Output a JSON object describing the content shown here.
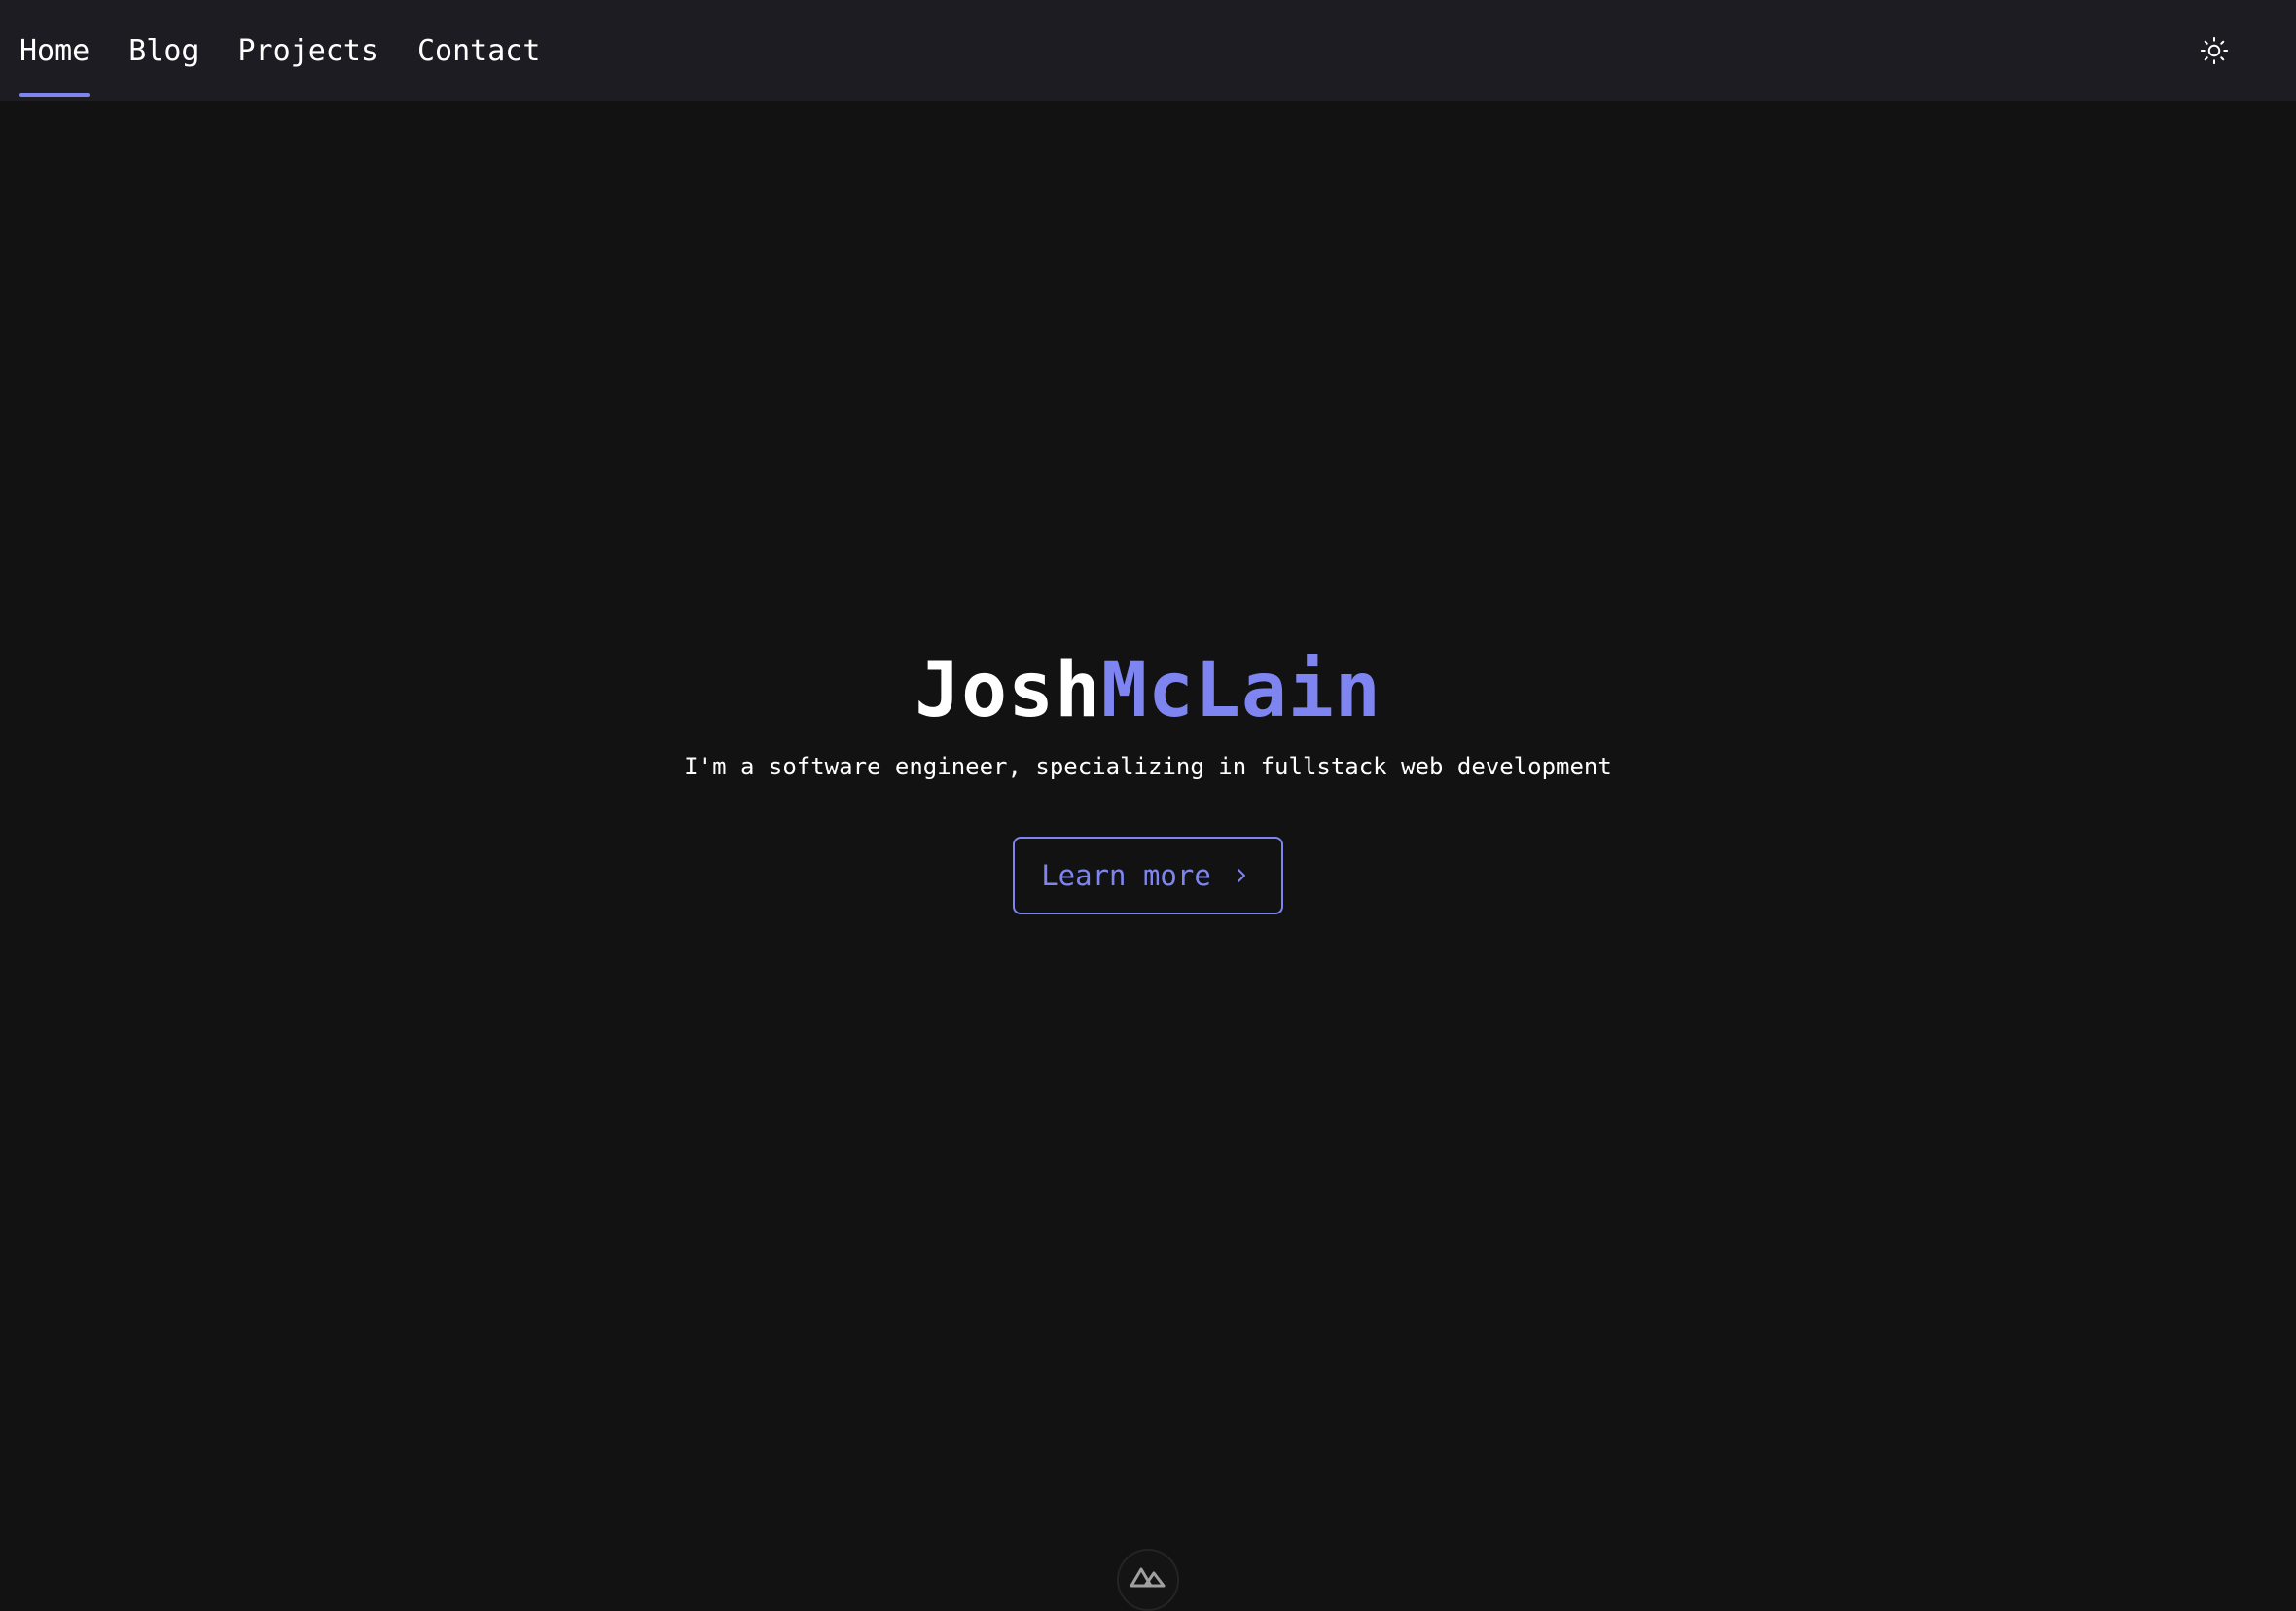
{
  "theme": {
    "accent": "#7f85f0",
    "background": "#121212",
    "navbar_background": "#1c1c22",
    "text": "#ffffff"
  },
  "nav": {
    "items": [
      {
        "label": "Home",
        "active": true
      },
      {
        "label": "Blog",
        "active": false
      },
      {
        "label": "Projects",
        "active": false
      },
      {
        "label": "Contact",
        "active": false
      }
    ],
    "theme_toggle_icon": "sun-icon"
  },
  "hero": {
    "first_name": "Josh",
    "last_name": "McLain",
    "subtitle": "I'm a software engineer, specializing in fullstack web development",
    "cta_label": "Learn more",
    "cta_icon": "chevron-right-icon"
  },
  "footer": {
    "badge_icon": "nuxt-logo-icon"
  }
}
